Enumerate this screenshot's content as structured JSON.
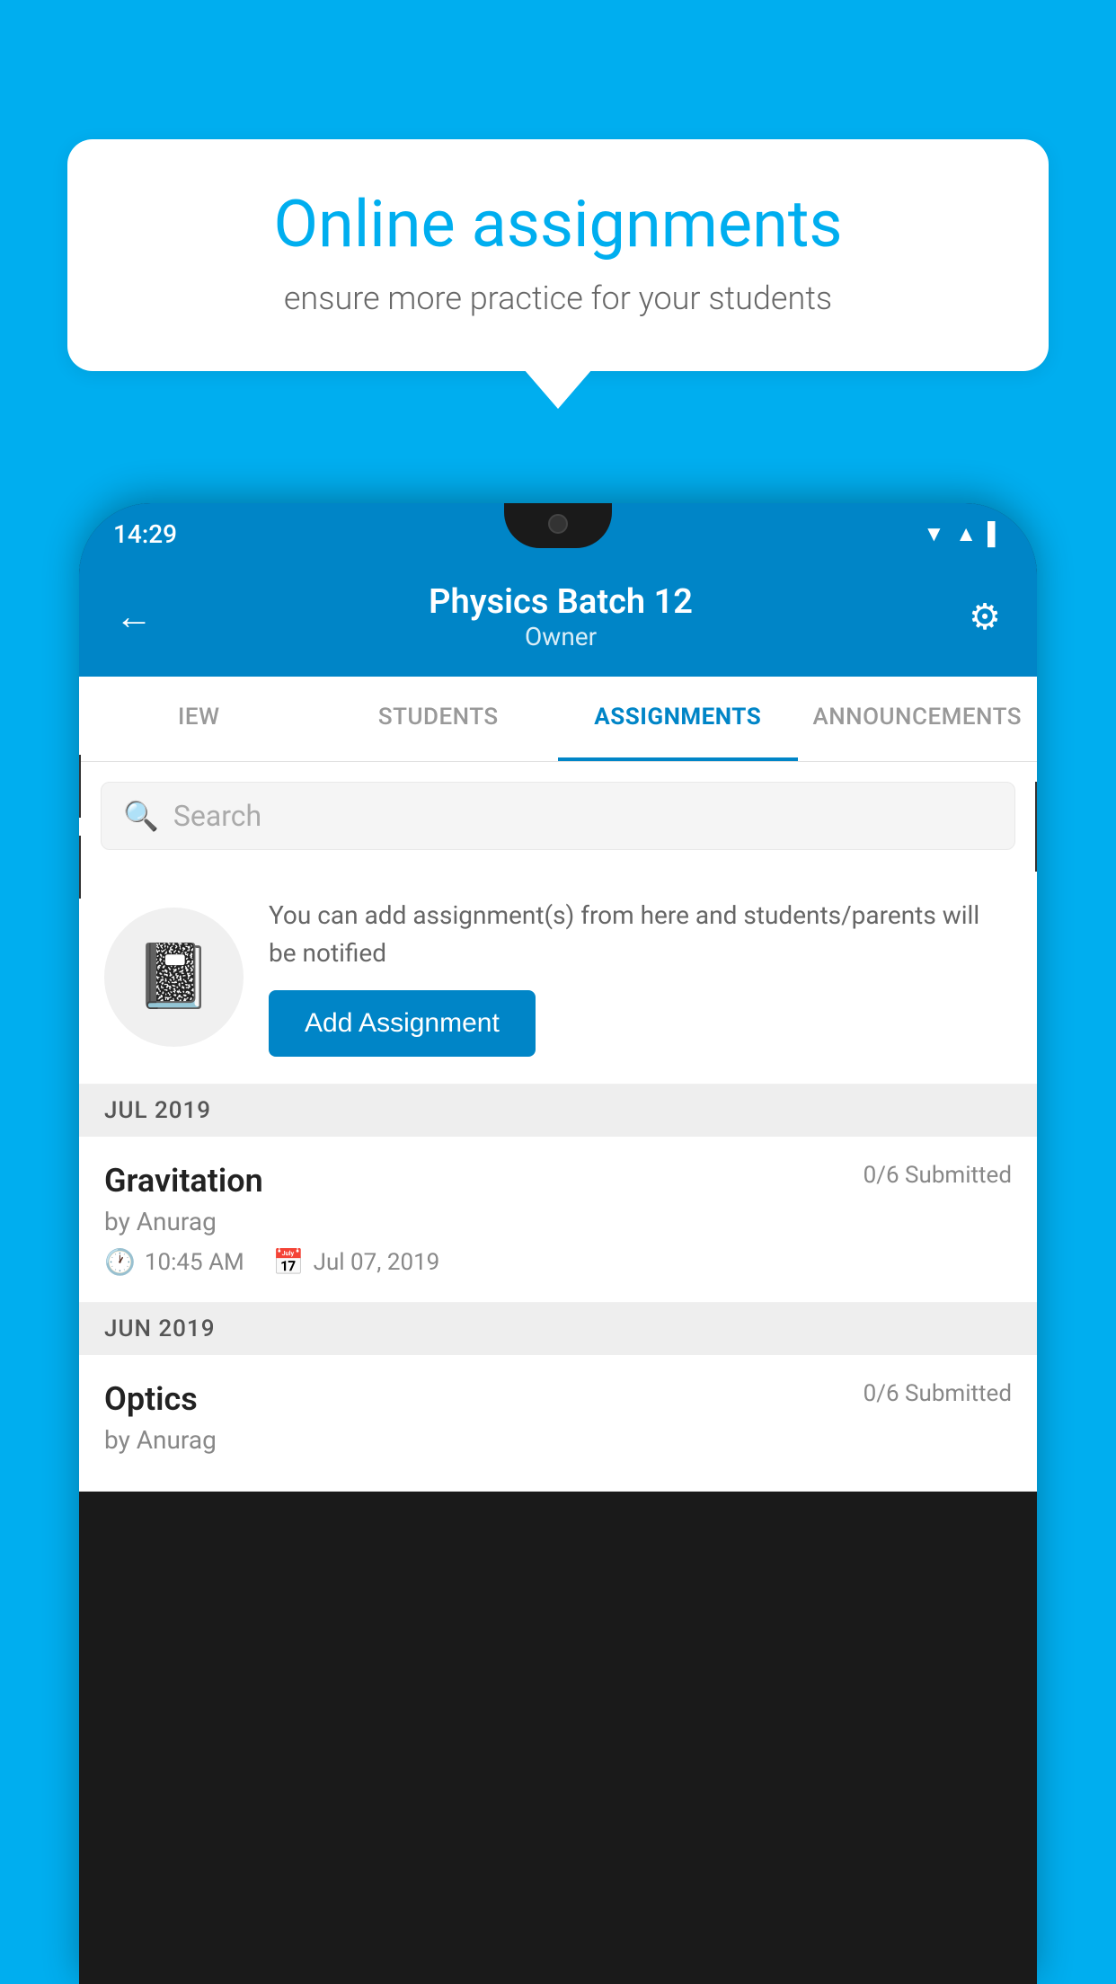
{
  "background_color": "#00AEEF",
  "speech_bubble": {
    "title": "Online assignments",
    "subtitle": "ensure more practice for your students"
  },
  "phone": {
    "status_bar": {
      "time": "14:29",
      "icons": [
        "wifi",
        "signal",
        "battery"
      ]
    },
    "header": {
      "title": "Physics Batch 12",
      "subtitle": "Owner",
      "back_label": "←",
      "settings_label": "⚙"
    },
    "tabs": [
      {
        "label": "IEW",
        "active": false
      },
      {
        "label": "STUDENTS",
        "active": false
      },
      {
        "label": "ASSIGNMENTS",
        "active": true
      },
      {
        "label": "ANNOUNCEMENTS",
        "active": false
      }
    ],
    "search": {
      "placeholder": "Search"
    },
    "promo": {
      "text": "You can add assignment(s) from here and students/parents will be notified",
      "button_label": "Add Assignment"
    },
    "sections": [
      {
        "header": "JUL 2019",
        "assignments": [
          {
            "name": "Gravitation",
            "submitted": "0/6 Submitted",
            "author": "by Anurag",
            "time": "10:45 AM",
            "date": "Jul 07, 2019"
          }
        ]
      },
      {
        "header": "JUN 2019",
        "assignments": [
          {
            "name": "Optics",
            "submitted": "0/6 Submitted",
            "author": "by Anurag",
            "time": "",
            "date": ""
          }
        ]
      }
    ]
  }
}
